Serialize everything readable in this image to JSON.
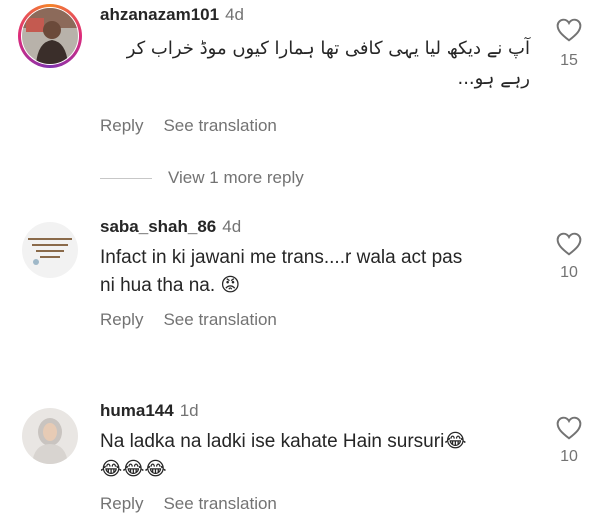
{
  "comments": [
    {
      "username": "ahzanazam101",
      "age": "4d",
      "text_line1": "آپ نے دیکھ لیا یہی کافی تھا ہمارا کیوں موڈ خراب کر",
      "text_line2": "رہے ہو...",
      "likes": "15",
      "reply_label": "Reply",
      "translate_label": "See translation",
      "avatar_icon": "profile-photo-man"
    },
    {
      "username": "saba_shah_86",
      "age": "4d",
      "text_line1": "Infact in ki jawani me trans....r wala act pas",
      "text_line2": "ni hua tha na. 😡",
      "likes": "10",
      "reply_label": "Reply",
      "translate_label": "See translation",
      "avatar_icon": "profile-photo-quote"
    },
    {
      "username": "huma144",
      "age": "1d",
      "text_line1": "Na ladka na ladki ise kahate Hain sursuri😂",
      "text_line2": "😂😂😂",
      "likes": "10",
      "reply_label": "Reply",
      "translate_label": "See translation",
      "avatar_icon": "profile-photo-woman"
    }
  ],
  "view_replies": "View 1 more reply",
  "colors": {
    "text": "#262626",
    "secondary": "#737373",
    "divider": "#c7c7c7"
  }
}
